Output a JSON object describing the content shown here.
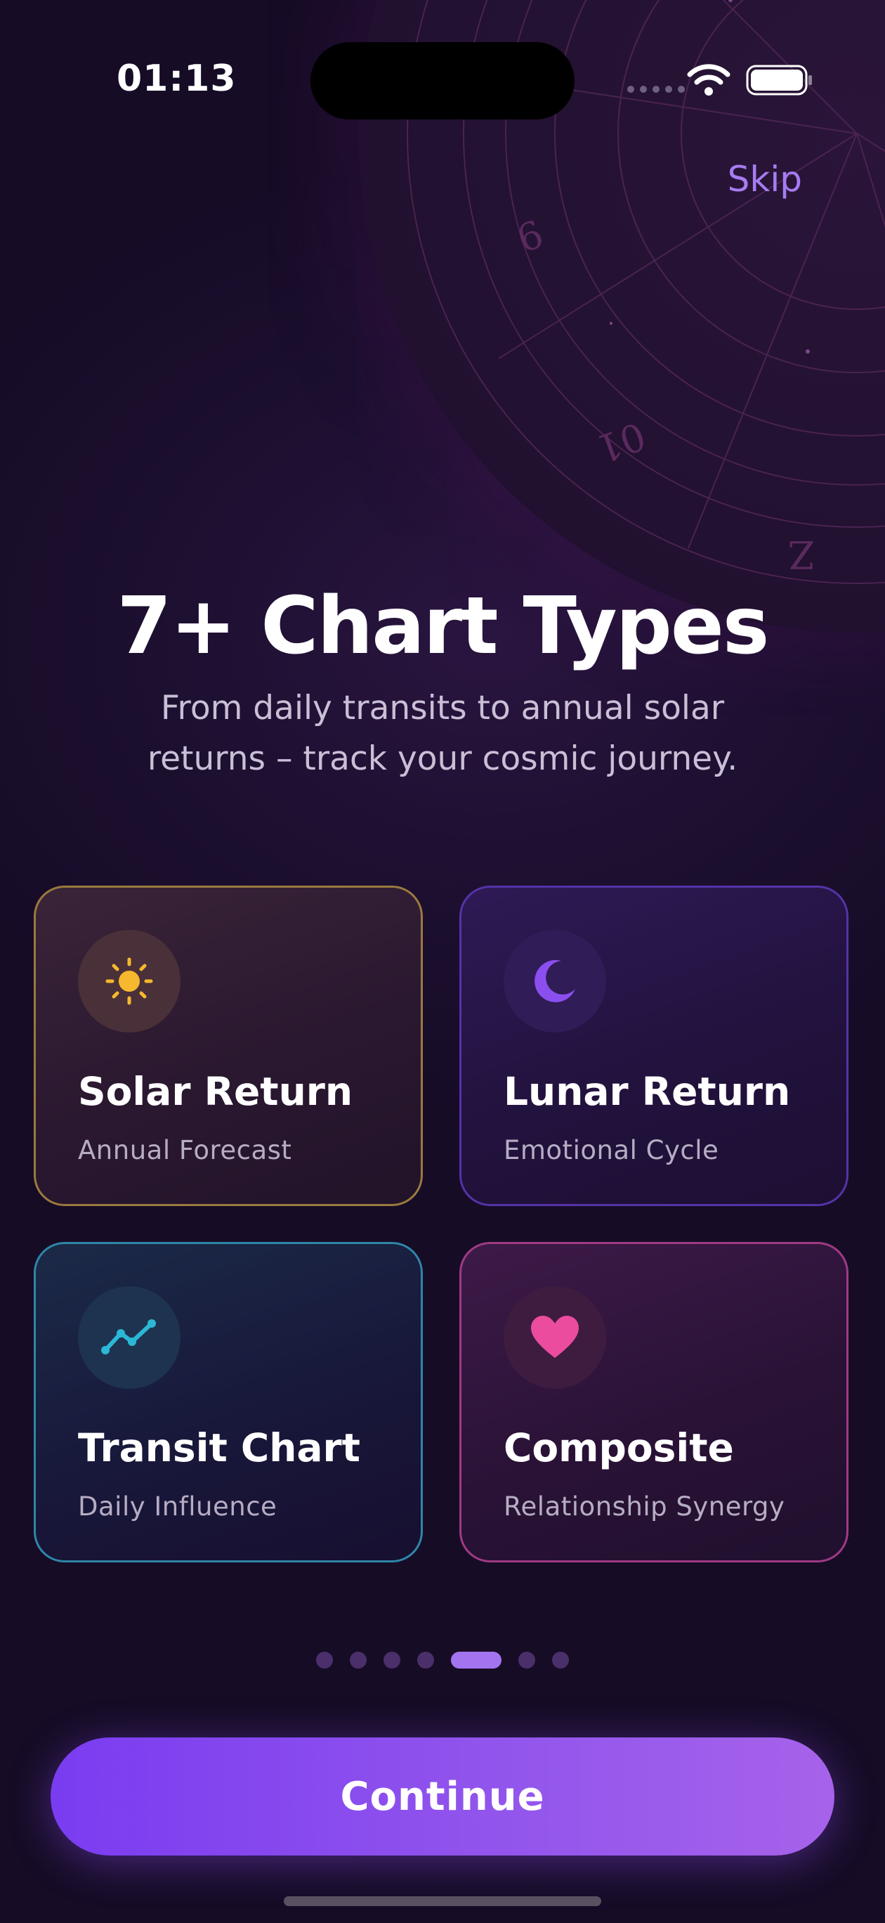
{
  "status_bar": {
    "time": "01:13",
    "icons": [
      "signal-dots-icon",
      "wifi-icon",
      "battery-icon"
    ]
  },
  "header": {
    "skip_label": "Skip"
  },
  "hero": {
    "title": "7+ Chart Types",
    "subtitle": "From daily transits to annual solar returns – track your cosmic journey."
  },
  "cards": [
    {
      "title": "Solar Return",
      "subtitle": "Annual Forecast",
      "icon": "sun-icon",
      "accent": "#f5b82e"
    },
    {
      "title": "Lunar Return",
      "subtitle": "Emotional Cycle",
      "icon": "moon-icon",
      "accent": "#8b4ff0"
    },
    {
      "title": "Transit Chart",
      "subtitle": "Daily Influence",
      "icon": "trend-line-icon",
      "accent": "#2bb8d6"
    },
    {
      "title": "Composite",
      "subtitle": "Relationship Synergy",
      "icon": "heart-icon",
      "accent": "#ec4c9e"
    }
  ],
  "pager": {
    "total": 7,
    "active_index": 4
  },
  "footer": {
    "continue_label": "Continue"
  },
  "colors": {
    "background": "#1a0e2c",
    "accent_purple": "#a374f0",
    "button_start": "#7a3cf0",
    "button_end": "#a662ea"
  }
}
